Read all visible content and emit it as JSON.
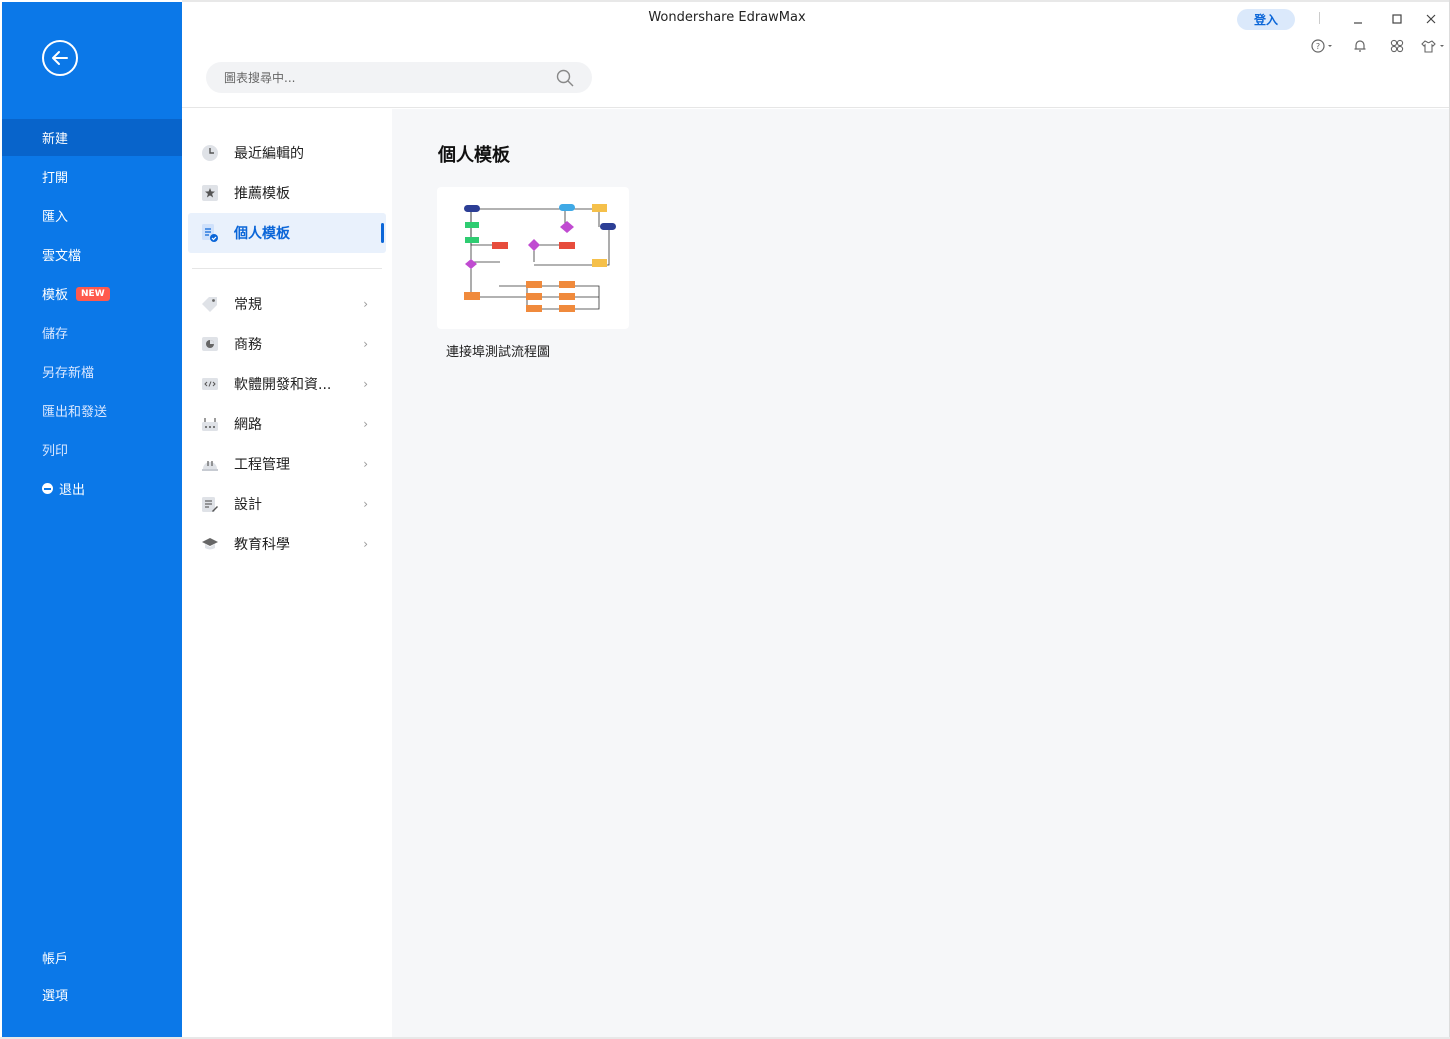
{
  "app": {
    "title": "Wondershare EdrawMax",
    "login": "登入"
  },
  "search": {
    "placeholder": "圖表搜尋中..."
  },
  "sidebar": {
    "items": [
      {
        "label": "新建"
      },
      {
        "label": "打開"
      },
      {
        "label": "匯入"
      },
      {
        "label": "雲文檔"
      },
      {
        "label": "模板",
        "badge": "NEW"
      },
      {
        "label": "儲存"
      },
      {
        "label": "另存新檔"
      },
      {
        "label": "匯出和發送"
      },
      {
        "label": "列印"
      },
      {
        "label": "退出"
      }
    ],
    "bottom": [
      {
        "label": "帳戶"
      },
      {
        "label": "選項"
      }
    ]
  },
  "categories": {
    "top": [
      {
        "label": "最近編輯的",
        "icon": "clock-icon"
      },
      {
        "label": "推薦模板",
        "icon": "star-icon"
      },
      {
        "label": "個人模板",
        "icon": "personal-template-icon"
      }
    ],
    "groups": [
      {
        "label": "常規",
        "icon": "tag-icon"
      },
      {
        "label": "商務",
        "icon": "business-icon"
      },
      {
        "label": "軟體開發和資...",
        "icon": "code-icon"
      },
      {
        "label": "網路",
        "icon": "network-icon"
      },
      {
        "label": "工程管理",
        "icon": "helmet-icon"
      },
      {
        "label": "設計",
        "icon": "design-icon"
      },
      {
        "label": "教育科學",
        "icon": "graduation-cap-icon"
      }
    ]
  },
  "main": {
    "title": "個人模板",
    "templates": [
      {
        "name": "連接埠測試流程圖"
      }
    ]
  },
  "colors": {
    "sidebar": "#0b78e8",
    "sidebar_active": "#0864cb",
    "accent": "#0b66d8",
    "badge": "#ff5a4d"
  }
}
